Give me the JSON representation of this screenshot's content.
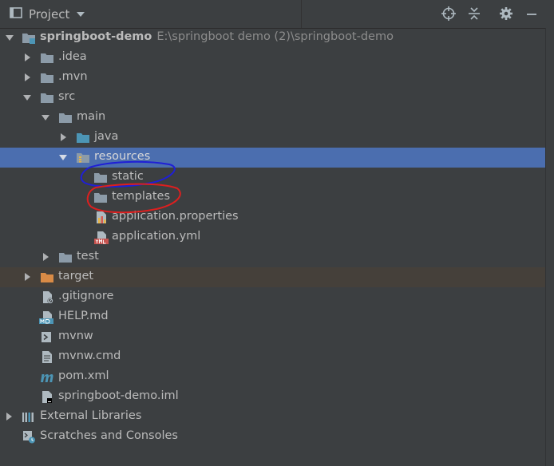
{
  "panel": {
    "title": "Project",
    "icons": [
      "project-panel-icon",
      "dropdown-caret-icon",
      "locate-icon",
      "collapse-all-icon",
      "gear-icon",
      "hide-icon"
    ]
  },
  "tree": {
    "root": {
      "name": "springboot-demo",
      "path": "E:\\springboot demo (2)\\springboot-demo"
    },
    "idea": ".idea",
    "mvn": ".mvn",
    "src": "src",
    "main": "main",
    "java": "java",
    "resources": "resources",
    "static": "static",
    "templates": "templates",
    "app_properties": "application.properties",
    "app_yml": "application.yml",
    "test": "test",
    "target": "target",
    "gitignore": ".gitignore",
    "help": "HELP.md",
    "mvnw": "mvnw",
    "mvnw_cmd": "mvnw.cmd",
    "pom": "pom.xml",
    "iml": "springboot-demo.iml",
    "external_libraries": "External Libraries",
    "scratches": "Scratches and Consoles"
  },
  "colors": {
    "background": "#3c3f41",
    "selection": "#4b6eaf",
    "excluded": "#45403a",
    "folder": "#8c9ba8",
    "source_folder": "#4c95b5",
    "target_folder": "#d98b46",
    "blue_annotation": "#1f1fd6",
    "red_annotation": "#dd1f1f"
  }
}
